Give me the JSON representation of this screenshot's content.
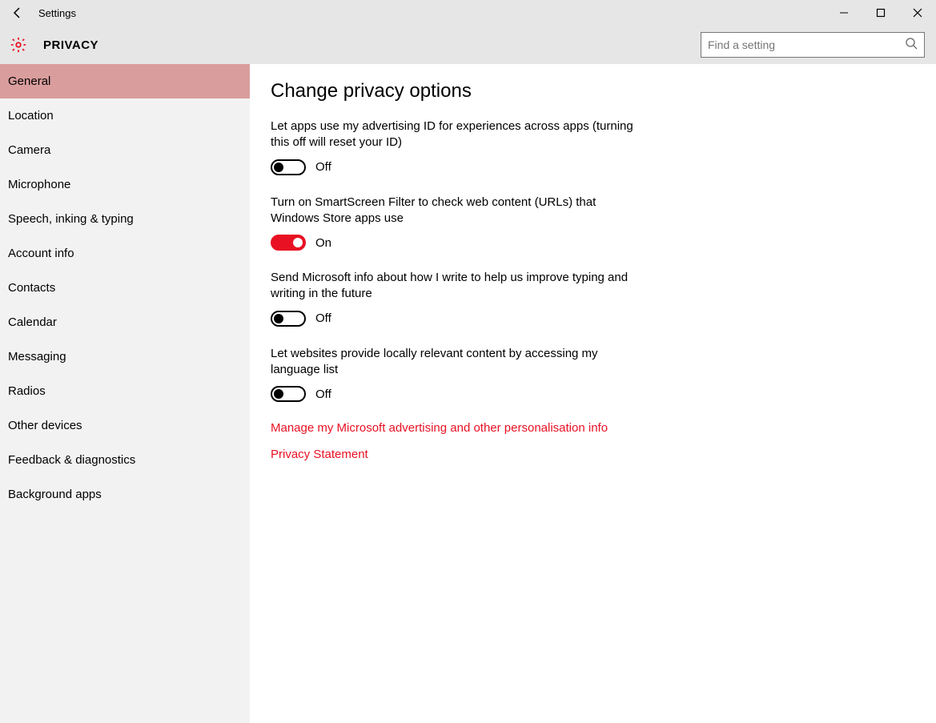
{
  "titlebar": {
    "app": "Settings"
  },
  "header": {
    "section": "PRIVACY",
    "search_placeholder": "Find a setting"
  },
  "sidebar": {
    "items": [
      {
        "label": "General",
        "active": true
      },
      {
        "label": "Location",
        "active": false
      },
      {
        "label": "Camera",
        "active": false
      },
      {
        "label": "Microphone",
        "active": false
      },
      {
        "label": "Speech, inking & typing",
        "active": false
      },
      {
        "label": "Account info",
        "active": false
      },
      {
        "label": "Contacts",
        "active": false
      },
      {
        "label": "Calendar",
        "active": false
      },
      {
        "label": "Messaging",
        "active": false
      },
      {
        "label": "Radios",
        "active": false
      },
      {
        "label": "Other devices",
        "active": false
      },
      {
        "label": "Feedback & diagnostics",
        "active": false
      },
      {
        "label": "Background apps",
        "active": false
      }
    ]
  },
  "main": {
    "heading": "Change privacy options",
    "settings": [
      {
        "desc": "Let apps use my advertising ID for experiences across apps (turning this off will reset your ID)",
        "value": "Off",
        "on": false
      },
      {
        "desc": "Turn on SmartScreen Filter to check web content (URLs) that Windows Store apps use",
        "value": "On",
        "on": true
      },
      {
        "desc": "Send Microsoft info about how I write to help us improve typing and writing in the future",
        "value": "Off",
        "on": false
      },
      {
        "desc": "Let websites provide locally relevant content by accessing my language list",
        "value": "Off",
        "on": false
      }
    ],
    "links": [
      "Manage my Microsoft advertising and other personalisation info",
      "Privacy Statement"
    ]
  }
}
